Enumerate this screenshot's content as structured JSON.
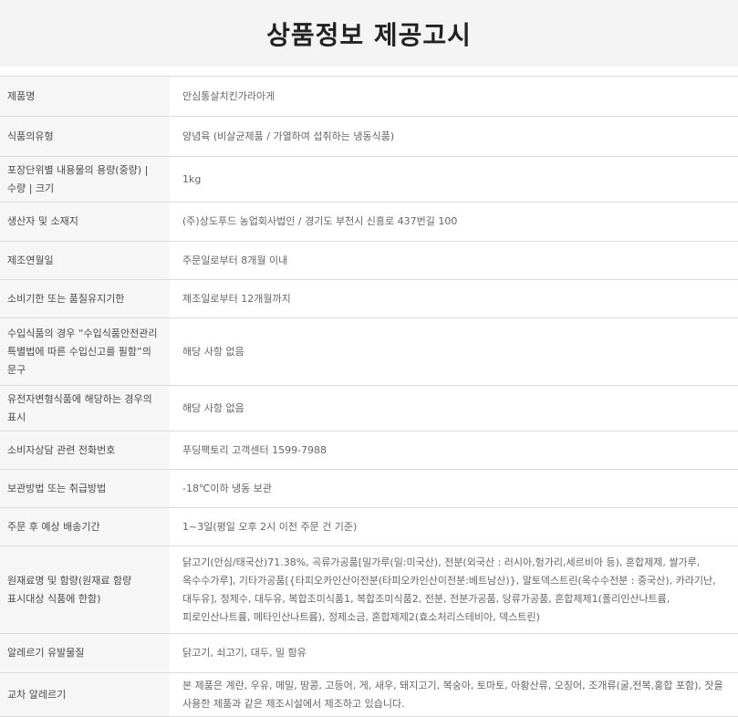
{
  "title": "상품정보 제공고시",
  "rows": [
    {
      "label": "제품명",
      "value": "안심통살치킨가라아게"
    },
    {
      "label": "식품의유형",
      "value": "양념육 (비살균제품 / 가열하여 섭취하는 냉동식품)"
    },
    {
      "label": "포장단위별 내용물의 용량(중량) | 수량 | 크기",
      "value": "1kg"
    },
    {
      "label": "생산자 및 소재지",
      "value": "(주)상도푸드 농업회사법인 / 경기도 부천시 신흥로 437번길 100"
    },
    {
      "label": "제조연월일",
      "value": "주문일로부터 8개월 이내"
    },
    {
      "label": "소비기한 또는 품질유지기한",
      "value": "제조일로부터 12개월까지"
    },
    {
      "label": "수입식품의 경우 “수입식품안전관리 특별법에 따른 수입신고를 필함”의 문구",
      "value": "해당 사항 없음"
    },
    {
      "label": "유전자변형식품에 해당하는 경우의 표시",
      "value": "해당 사항 없음"
    },
    {
      "label": "소비자상담 관련 전화번호",
      "value": "푸딩팩토리 고객센터 1599-7988"
    },
    {
      "label": "보관방법 또는 취급방법",
      "value": "-18℃이하 냉동 보관"
    },
    {
      "label": "주문 후 예상 배송기간",
      "value": "1~3일(평일 오후 2시 이전 주문 건 기준)"
    },
    {
      "label": "원재료명 및 함량(원재료 함량 표시대상 식품에 한함)",
      "value": "닭고기(안심/태국산)71.38%, 곡류가공품[밀가루(밀:미국산), 전분(외국산 : 러시아,헝가리,세르비아 등), 혼합제제, 쌀가루, 옥수수가루], 기타가공품[{타피오카인산이전분(타피오카인산이전분:베트남산)}, 말토덱스트린(옥수수전분 : 중국산), 카라기난, 대두유], 정제수, 대두유, 복합조미식품1, 복합조미식품2, 전분, 전분가공품, 당류가공품, 혼합제제1(폴리인산나트륨, 피로인산나트륨, 메타인산나트륨), 정제소금, 혼합제제2(효소처리스테비아, 덱스트린)"
    },
    {
      "label": "알레르기 유발물질",
      "value": "닭고기, 쇠고기, 대두, 밀 함유"
    },
    {
      "label": "교차 알레르기",
      "value": "본 제품은 계란, 우유, 메밀, 땅콩, 고등어, 게, 새우, 돼지고기, 복숭아, 토마토, 아황산류, 오징어, 조개류(굴,전복,홍합 포함), 잣을 사용한 제품과 같은 제조시설에서 제조하고 있습니다."
    }
  ]
}
